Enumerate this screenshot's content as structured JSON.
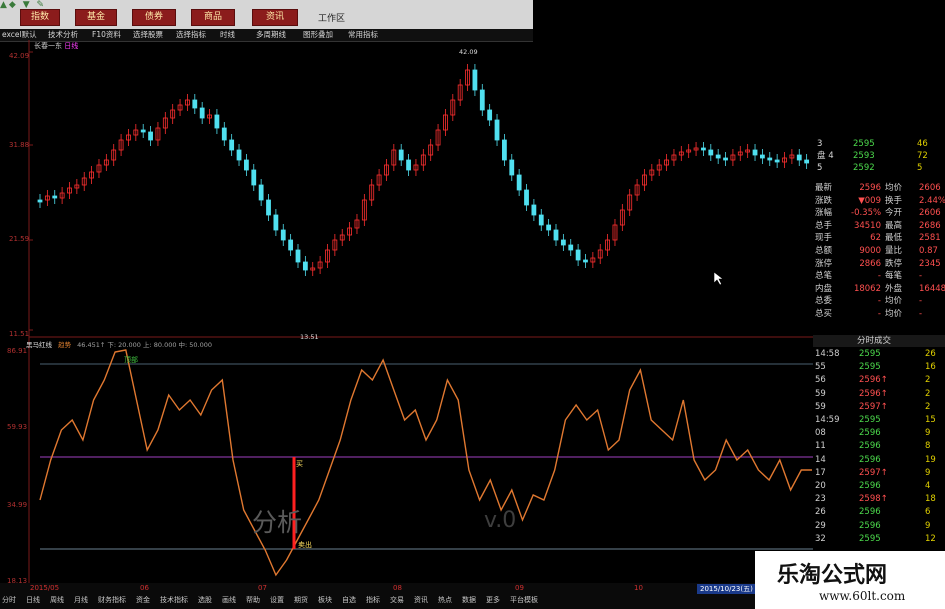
{
  "toolbar": {
    "buttons": [
      "指数",
      "基金",
      "债券",
      "商品",
      "资讯"
    ],
    "workspace": "工作区"
  },
  "menubar": {
    "items": [
      "excel默认",
      "技术分析",
      "F10资料",
      "选择股票",
      "选择指标",
      "时线",
      "多周期线",
      "图形叠加",
      "常用指标"
    ]
  },
  "main_chart": {
    "title": "长春一东",
    "title_tag": "日线",
    "y_labels": [
      "42.09",
      "31.88",
      "21.59",
      "11.51"
    ],
    "peak_label": "42.09",
    "low_label": "13.51"
  },
  "indicator": {
    "name": "黑马红线",
    "tag": "趋势",
    "params": "46.451↑  下: 20.000  上: 80.000  中: 50.000",
    "y_labels": [
      "86.91",
      "59.93",
      "34.99",
      "18.13"
    ],
    "top_label": "顶部",
    "buy_label": "买",
    "sell_label": "卖出"
  },
  "quote_panel": {
    "order_rows": [
      {
        "label": "3",
        "price": "2595",
        "vol": "46"
      },
      {
        "label": "盘 4",
        "price": "2593",
        "vol": "72"
      },
      {
        "label": "5",
        "price": "2592",
        "vol": "5"
      }
    ],
    "stats": [
      {
        "k": "最新",
        "v": "2596",
        "k2": "均价",
        "v2": "2606"
      },
      {
        "k": "涨跌",
        "v": "▼009",
        "k2": "换手",
        "v2": "2.44%"
      },
      {
        "k": "涨幅",
        "v": "-0.35%",
        "k2": "今开",
        "v2": "2606"
      },
      {
        "k": "总手",
        "v": "34510",
        "k2": "最高",
        "v2": "2686"
      },
      {
        "k": "现手",
        "v": "62",
        "k2": "最低",
        "v2": "2581"
      },
      {
        "k": "总额",
        "v": "9000",
        "k2": "量比",
        "v2": "0.87"
      },
      {
        "k": "涨停",
        "v": "2866",
        "k2": "跌停",
        "v2": "2345"
      },
      {
        "k": "总笔",
        "v": "-",
        "k2": "每笔",
        "v2": "-"
      },
      {
        "k": "内盘",
        "v": "18062",
        "k2": "外盘",
        "v2": "16448"
      },
      {
        "k": "总委",
        "v": "-",
        "k2": "均价",
        "v2": "-"
      },
      {
        "k": "总买",
        "v": "-",
        "k2": "均价",
        "v2": "-"
      }
    ],
    "ticks_header": "分时成交",
    "ticks": [
      {
        "t": "14:58",
        "p": "2595",
        "v": "26"
      },
      {
        "t": "55",
        "p": "2595",
        "v": "16"
      },
      {
        "t": "56",
        "p": "2596↑",
        "v": "2"
      },
      {
        "t": "59",
        "p": "2596↑",
        "v": "2"
      },
      {
        "t": "59",
        "p": "2597↑",
        "v": "2"
      },
      {
        "t": "14:59",
        "p": "2595",
        "v": "15"
      },
      {
        "t": "08",
        "p": "2596",
        "v": "9"
      },
      {
        "t": "11",
        "p": "2596",
        "v": "8"
      },
      {
        "t": "14",
        "p": "2596",
        "v": "19"
      },
      {
        "t": "17",
        "p": "2597↑",
        "v": "9"
      },
      {
        "t": "20",
        "p": "2596",
        "v": "4"
      },
      {
        "t": "23",
        "p": "2598↑",
        "v": "18"
      },
      {
        "t": "26",
        "p": "2596",
        "v": "6"
      },
      {
        "t": "29",
        "p": "2596",
        "v": "9"
      },
      {
        "t": "32",
        "p": "2595",
        "v": "12"
      }
    ]
  },
  "date_axis": {
    "labels": [
      "2015/05",
      "06",
      "07",
      "08",
      "09",
      "10"
    ],
    "current": "2015/10/23(五)"
  },
  "bottom_tabs": [
    "分时",
    "日线",
    "周线",
    "月线",
    "财务指标",
    "资金",
    "技术指标",
    "选股",
    "画线",
    "帮助",
    "设置",
    "期货",
    "板块",
    "自选",
    "指标",
    "交易",
    "资讯",
    "热点",
    "数据",
    "更多",
    "平台模板"
  ],
  "ghost_text": {
    "left": "分析",
    "right": "v.0"
  },
  "watermark": {
    "title": "乐淘公式网",
    "url": "www.60lt.com"
  },
  "colors": {
    "up": "#ff3030",
    "down": "#50e0f0",
    "line": "#e07830",
    "ref_top": "#4a6070",
    "ref_mid": "#a040c0",
    "ref_low": "#6a8090"
  }
}
